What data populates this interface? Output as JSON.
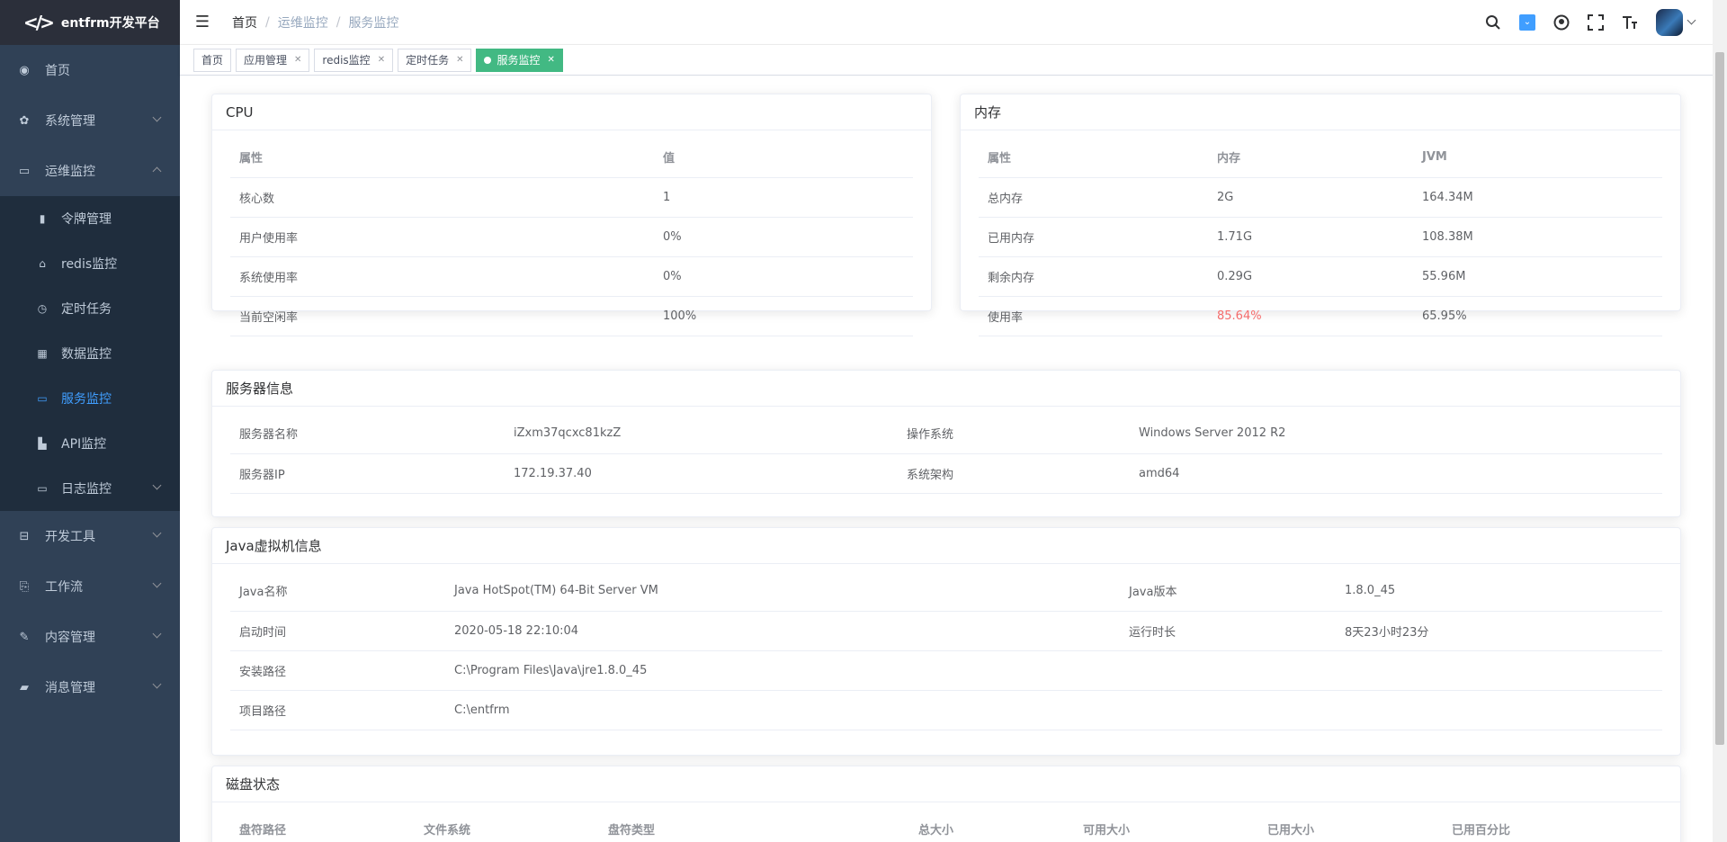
{
  "app": {
    "title": "entfrm开发平台"
  },
  "sidebar": {
    "items": [
      {
        "label": "首页",
        "icon": "dashboard-icon"
      },
      {
        "label": "系统管理",
        "icon": "gear-icon"
      },
      {
        "label": "运维监控",
        "icon": "monitor-icon"
      },
      {
        "label": "开发工具",
        "icon": "toolbox-icon"
      },
      {
        "label": "工作流",
        "icon": "workflow-icon"
      },
      {
        "label": "内容管理",
        "icon": "edit-icon"
      },
      {
        "label": "消息管理",
        "icon": "message-icon"
      }
    ],
    "sub_items": [
      {
        "label": "令牌管理",
        "icon": "token-icon"
      },
      {
        "label": "redis监控",
        "icon": "redis-icon"
      },
      {
        "label": "定时任务",
        "icon": "clock-icon"
      },
      {
        "label": "数据监控",
        "icon": "database-icon"
      },
      {
        "label": "服务监控",
        "icon": "server-icon"
      },
      {
        "label": "API监控",
        "icon": "chart-bar-icon"
      },
      {
        "label": "日志监控",
        "icon": "log-icon"
      }
    ]
  },
  "breadcrumb": [
    "首页",
    "运维监控",
    "服务监控"
  ],
  "tags": [
    "首页",
    "应用管理",
    "redis监控",
    "定时任务",
    "服务监控"
  ],
  "cpu": {
    "title": "CPU",
    "headers": [
      "属性",
      "值"
    ],
    "rows": [
      [
        "核心数",
        "1"
      ],
      [
        "用户使用率",
        "0%"
      ],
      [
        "系统使用率",
        "0%"
      ],
      [
        "当前空闲率",
        "100%"
      ]
    ]
  },
  "memory": {
    "title": "内存",
    "headers": [
      "属性",
      "内存",
      "JVM"
    ],
    "rows": [
      [
        "总内存",
        "2G",
        "164.34M"
      ],
      [
        "已用内存",
        "1.71G",
        "108.38M"
      ],
      [
        "剩余内存",
        "0.29G",
        "55.96M"
      ],
      [
        "使用率",
        "85.64%",
        "65.95%"
      ]
    ]
  },
  "server": {
    "title": "服务器信息",
    "rows": [
      [
        "服务器名称",
        "iZxm37qcxc81kzZ",
        "操作系统",
        "Windows Server 2012 R2"
      ],
      [
        "服务器IP",
        "172.19.37.40",
        "系统架构",
        "amd64"
      ]
    ]
  },
  "jvm": {
    "title": "Java虚拟机信息",
    "rows": [
      [
        "Java名称",
        "Java HotSpot(TM) 64-Bit Server VM",
        "Java版本",
        "1.8.0_45"
      ],
      [
        "启动时间",
        "2020-05-18 22:10:04",
        "运行时长",
        "8天23小时23分"
      ],
      [
        "安装路径",
        "C:\\Program Files\\Java\\jre1.8.0_45",
        "",
        ""
      ],
      [
        "项目路径",
        "C:\\entfrm",
        "",
        ""
      ]
    ]
  },
  "disk": {
    "title": "磁盘状态",
    "headers": [
      "盘符路径",
      "文件系统",
      "盘符类型",
      "总大小",
      "可用大小",
      "已用大小",
      "已用百分比"
    ]
  },
  "colors": {
    "accent": "#409eff",
    "tag_active": "#42b983",
    "warn": "#f56c6c",
    "sidebar": "#304156"
  }
}
